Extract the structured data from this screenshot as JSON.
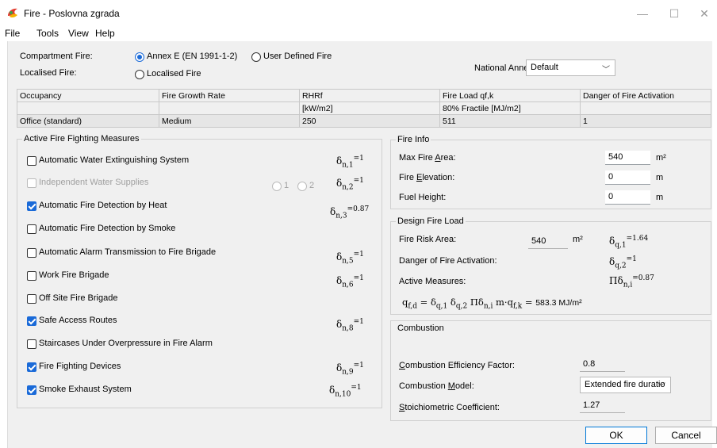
{
  "window": {
    "title": "Fire - Poslovna zgrada",
    "minimize": "—",
    "maximize": "☐",
    "close": "✕"
  },
  "menu": [
    "File",
    "Tools",
    "View",
    "Help"
  ],
  "fire_type": {
    "compartment_label": "Compartment Fire:",
    "localised_label": "Localised Fire:",
    "annex_e": "Annex E (EN 1991-1-2)",
    "user_defined": "User Defined Fire",
    "localised": "Localised Fire",
    "national_annex_label": "National Annex:",
    "national_annex_value": "Default"
  },
  "occupancy_table": {
    "headers": [
      "Occupancy",
      "Fire Growth Rate",
      "RHRf",
      "Fire Load qf,k",
      "Danger of Fire Activation"
    ],
    "units": [
      "",
      "",
      "[kW/m2]",
      "80% Fractile [MJ/m2]",
      ""
    ],
    "values": [
      "Office (standard)",
      "Medium",
      "250",
      "511",
      "1"
    ]
  },
  "active_measures": {
    "title": "Active Fire Fighting Measures",
    "items": [
      {
        "label": "Automatic Water Extinguishing System",
        "checked": false,
        "disabled": false
      },
      {
        "label": "Independent Water Supplies",
        "checked": false,
        "disabled": true
      },
      {
        "label": "Automatic Fire Detection by Heat",
        "checked": true,
        "disabled": false
      },
      {
        "label": "Automatic Fire Detection by Smoke",
        "checked": false,
        "disabled": false
      },
      {
        "label": "Automatic Alarm Transmission to Fire Brigade",
        "checked": false,
        "disabled": false
      },
      {
        "label": "Work Fire Brigade",
        "checked": false,
        "disabled": false
      },
      {
        "label": "Off Site Fire Brigade",
        "checked": false,
        "disabled": false
      },
      {
        "label": "Safe Access Routes",
        "checked": true,
        "disabled": false
      },
      {
        "label": "Staircases Under Overpressure in Fire Alarm",
        "checked": false,
        "disabled": false
      },
      {
        "label": "Fire Fighting Devices",
        "checked": true,
        "disabled": false
      },
      {
        "label": "Smoke Exhaust System",
        "checked": true,
        "disabled": false
      }
    ],
    "water_supply_options": [
      "1",
      "2"
    ],
    "deltas": [
      {
        "sub": "n,1",
        "val": "1"
      },
      {
        "sub": "n,2",
        "val": "1"
      },
      {
        "sub": "n,3",
        "val": "0.87"
      },
      {
        "sub": "n,5",
        "val": "1"
      },
      {
        "sub": "n,6",
        "val": "1"
      },
      {
        "sub": "n,8",
        "val": "1"
      },
      {
        "sub": "n,9",
        "val": "1"
      },
      {
        "sub": "n,10",
        "val": "1"
      }
    ]
  },
  "fire_info": {
    "title": "Fire Info",
    "max_area_label": "Max Fire Area:",
    "max_area_value": "540",
    "max_area_unit": "m²",
    "elevation_label": "Fire Elevation:",
    "elevation_value": "0",
    "elevation_unit": "m",
    "fuel_height_label": "Fuel Height:",
    "fuel_height_value": "0",
    "fuel_height_unit": "m"
  },
  "design_fire_load": {
    "title": "Design Fire Load",
    "risk_area_label": "Fire Risk Area:",
    "risk_area_value": "540",
    "risk_area_unit": "m²",
    "dq1": {
      "sub": "q,1",
      "val": "1.64"
    },
    "danger_label": "Danger of Fire Activation:",
    "dq2": {
      "sub": "q,2",
      "val": "1"
    },
    "active_label": "Active Measures:",
    "pi_sub": "n,i",
    "pi_val": "0.87",
    "formula_result": "583.3 MJ/m²"
  },
  "combustion": {
    "title": "Combustion",
    "efficiency_label": "Combustion Efficiency Factor:",
    "efficiency_value": "0.8",
    "model_label": "Combustion Model:",
    "model_value": "Extended fire duratio",
    "stoich_label": "Stoichiometric Coefficient:",
    "stoich_value": "1.27"
  },
  "buttons": {
    "ok": "OK",
    "cancel": "Cancel"
  },
  "colors": {
    "accent": "#1a6ad8",
    "panel": "#f0f0f0"
  }
}
